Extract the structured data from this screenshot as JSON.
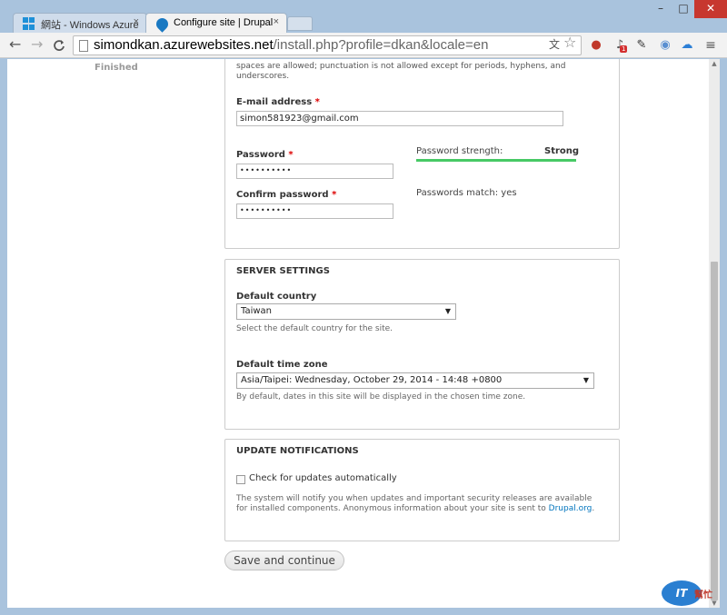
{
  "browser": {
    "tabs": [
      {
        "title": "網站 - Windows Azure",
        "icon": "windows-logo-icon",
        "close": "×"
      },
      {
        "title": "Configure site | Drupal",
        "icon": "drupal-drop-icon",
        "close": "×"
      }
    ],
    "window_controls": {
      "minimize": "–",
      "maximize": "□",
      "close": "✕"
    },
    "nav": {
      "back": "←",
      "forward": "→",
      "reload": "C"
    },
    "address": {
      "host": "simondkan.azurewebsites.net",
      "path": "/install.php?profile=dkan&locale=en"
    },
    "extensions": {
      "bell_badge": "1"
    }
  },
  "sidebar": {
    "finished_label": "Finished"
  },
  "user_account": {
    "cut_text": "spaces are allowed; punctuation is not allowed except for periods, hyphens, and underscores.",
    "email": {
      "label": "E-mail address",
      "required": "*",
      "value": "simon581923@gmail.com"
    },
    "password": {
      "label": "Password",
      "required": "*",
      "value": "••••••••••"
    },
    "confirm_password": {
      "label": "Confirm password",
      "required": "*",
      "value": "••••••••••"
    },
    "strength_label": "Password strength:",
    "strength_value": "Strong",
    "strength_level": 1.0,
    "match_text": "Passwords match: yes"
  },
  "server_settings": {
    "legend": "SERVER SETTINGS",
    "country": {
      "label": "Default country",
      "value": "Taiwan",
      "description": "Select the default country for the site."
    },
    "timezone": {
      "label": "Default time zone",
      "value": "Asia/Taipei: Wednesday, October 29, 2014 - 14:48 +0800",
      "description": "By default, dates in this site will be displayed in the chosen time zone."
    }
  },
  "update_notifications": {
    "legend": "UPDATE NOTIFICATIONS",
    "checkbox_label": "Check for updates automatically",
    "checked": false,
    "description_1": "The system will notify you when updates and important security releases are available",
    "description_2": "for installed components. Anonymous information about your site is sent to ",
    "link": "Drupal.org",
    "description_end": "."
  },
  "actions": {
    "save_label": "Save and continue"
  },
  "watermark": {
    "logo_text": "IT",
    "side_text": "幫忙"
  }
}
